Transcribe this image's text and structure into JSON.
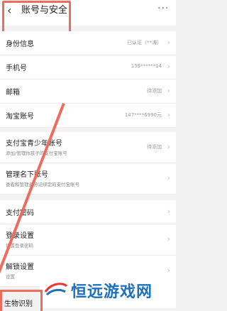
{
  "header": {
    "back_icon": "chevron-left-icon",
    "title": "账号与安全",
    "more_icon": "more-dots-icon",
    "more_glyph": "···"
  },
  "rows": [
    {
      "label": "身份信息",
      "value": "已认证（**涛）"
    },
    {
      "label": "手机号",
      "value": "159******14"
    },
    {
      "label": "邮箱",
      "value": "待添加"
    },
    {
      "label": "淘宝账号",
      "value": "147****6990元"
    },
    {
      "label": "支付宝青少年账号",
      "sub": "添加/管理你孩子的支付宝账号",
      "value": "待添加"
    },
    {
      "label": "管理名下账号",
      "sub": "查看和管理身份证绑定的支付宝账号",
      "value": ""
    },
    {
      "label": "支付密码",
      "value": ""
    },
    {
      "label": "登录设置",
      "sub": "设置登录密码",
      "value": ""
    },
    {
      "label": "解锁设置",
      "sub": "设置",
      "value": ""
    }
  ],
  "bottom": {
    "label": "生物识别"
  },
  "watermark": {
    "text": "恒远游戏网"
  },
  "colors": {
    "annotation": "#ec6d5d",
    "watermark": "#1d6fc0"
  }
}
